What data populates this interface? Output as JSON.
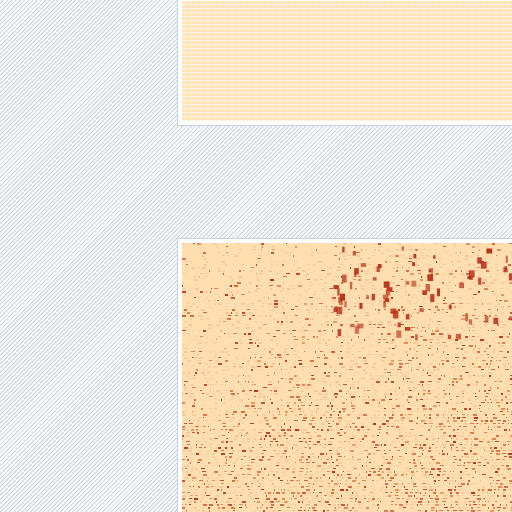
{
  "colors": {
    "page_stripe_light": "#f9f9fb",
    "page_stripe_dark": "#cfd2da",
    "panel_border": "#c9d2e0",
    "tile_base": "#ffe2b6",
    "tile_base_dense": "#ffdfb0",
    "density_low": "#f2c79a",
    "density_mid": "#d96a3a",
    "density_high": "#b8331d"
  },
  "panels": [
    {
      "name": "top-map-panel",
      "content": "light-density-tiles"
    },
    {
      "name": "bottom-map-panel",
      "content": "dense-density-tiles"
    }
  ]
}
